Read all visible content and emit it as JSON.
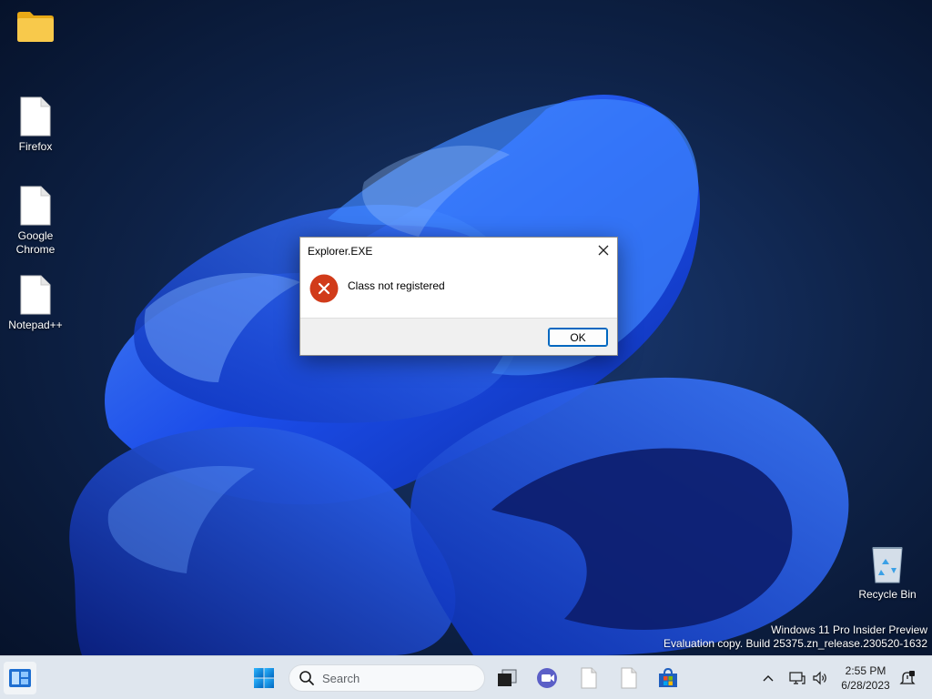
{
  "desktop": {
    "icons": [
      {
        "label": "",
        "icon": "folder-icon"
      },
      {
        "label": "Firefox",
        "icon": "file-icon"
      },
      {
        "label": "Google Chrome",
        "icon": "file-icon"
      },
      {
        "label": "Notepad++",
        "icon": "file-icon"
      },
      {
        "label": "Recycle Bin",
        "icon": "recycle-bin-icon"
      }
    ],
    "watermark": {
      "line1": "Windows 11 Pro Insider Preview",
      "line2": "Evaluation copy. Build 25375.zn_release.230520-1632"
    }
  },
  "dialog": {
    "title": "Explorer.EXE",
    "message": "Class not registered",
    "ok_label": "OK",
    "icon": "error-icon",
    "close_icon": "close-icon"
  },
  "taskbar": {
    "search_placeholder": "Search",
    "time": "2:55 PM",
    "date": "6/28/2023",
    "pinned": [
      "widgets-icon",
      "windows-start-icon",
      "search-icon",
      "task-view-icon",
      "meet-icon",
      "file-icon",
      "file-icon",
      "store-icon"
    ],
    "tray": [
      "chevron-up-icon",
      "network-icon",
      "volume-icon",
      "notification-icon"
    ]
  },
  "colors": {
    "accent": "#0067c0",
    "error": "#d13b1a",
    "folder": "#f8c94b",
    "wallpaper_dark": "#0a1a33",
    "wallpaper_bloom": "#1f5aff"
  }
}
